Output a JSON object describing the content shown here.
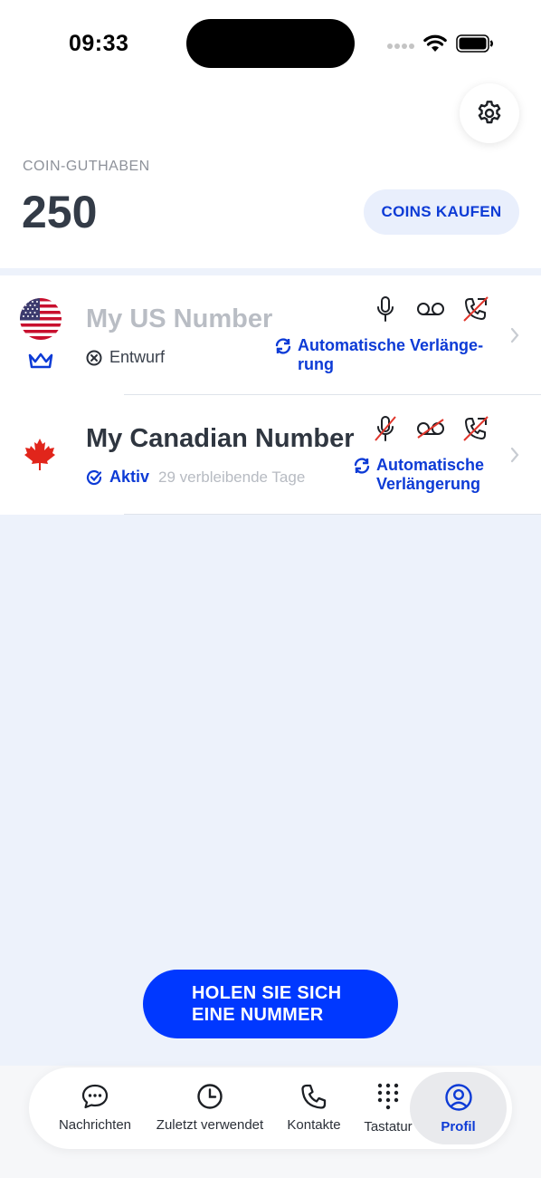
{
  "status_bar": {
    "time": "09:33"
  },
  "header": {
    "balance_label": "COIN-GUTHABEN",
    "balance_value": "250",
    "buy_button": "COINS KAUFEN"
  },
  "numbers": [
    {
      "name": "My US Number",
      "status": "Entwurf",
      "renewal_line1": "Automatische Verlänge-",
      "renewal_line2": "rung",
      "features": {
        "mic": "on",
        "voicemail": "on",
        "call_forward": "off"
      }
    },
    {
      "name": "My Canadian Number",
      "status": "Aktiv",
      "days_left": "29 verbleibende Tage",
      "renewal_line1": "Automatische",
      "renewal_line2": "Verlängerung",
      "features": {
        "mic": "off",
        "voicemail": "off",
        "call_forward": "off"
      }
    }
  ],
  "cta": {
    "line1": "HOLEN SIE SICH",
    "line2": "EINE NUMMER"
  },
  "tabs": [
    {
      "label": "Nachrichten",
      "icon": "chat-bubble-icon"
    },
    {
      "label": "Zuletzt verwendet",
      "icon": "clock-icon"
    },
    {
      "label": "Kontakte",
      "icon": "phone-icon"
    },
    {
      "label": "Tastatur",
      "icon": "keypad-icon"
    },
    {
      "label": "Profil",
      "icon": "profile-icon",
      "active": true
    }
  ],
  "colors": {
    "accent": "#0d3bd6",
    "cta": "#0038ff",
    "background": "#edf2fb",
    "disabled_red": "#e0352b"
  }
}
